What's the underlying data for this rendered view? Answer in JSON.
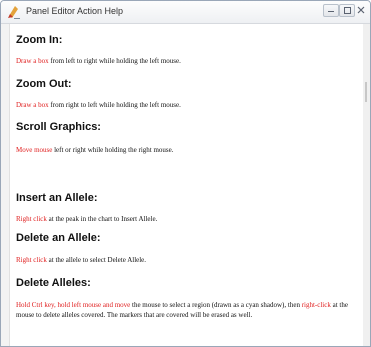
{
  "window": {
    "title": "Panel Editor Action Help"
  },
  "sections": [
    {
      "heading": "Zoom In:",
      "action": "Draw a box",
      "text": " from left to right while holding the left mouse."
    },
    {
      "heading": "Zoom Out:",
      "action": "Draw a box",
      "text": " from right to left while holding the left mouse."
    },
    {
      "heading": "Scroll Graphics:",
      "action": "Move mouse",
      "text": " left or right while holding the right mouse."
    },
    {
      "heading": "Insert an Allele:",
      "action": "Right click",
      "text": " at the peak in the chart to Insert Allele."
    },
    {
      "heading": "Delete an Allele:",
      "action": "Right click",
      "text": " at the allele to select Delete Allele."
    },
    {
      "heading": "Delete Alleles:",
      "action": "Hold Ctrl key, hold left mouse and move",
      "text_part1": " the mouse to select a region (drawn as a cyan shadow), then ",
      "action2": "right-click",
      "text_part2": " at the mouse to delete alleles covered. The markers that are covered will be erased as well."
    }
  ],
  "colors": {
    "action_text": "#e02020",
    "heading_text": "#111111"
  }
}
